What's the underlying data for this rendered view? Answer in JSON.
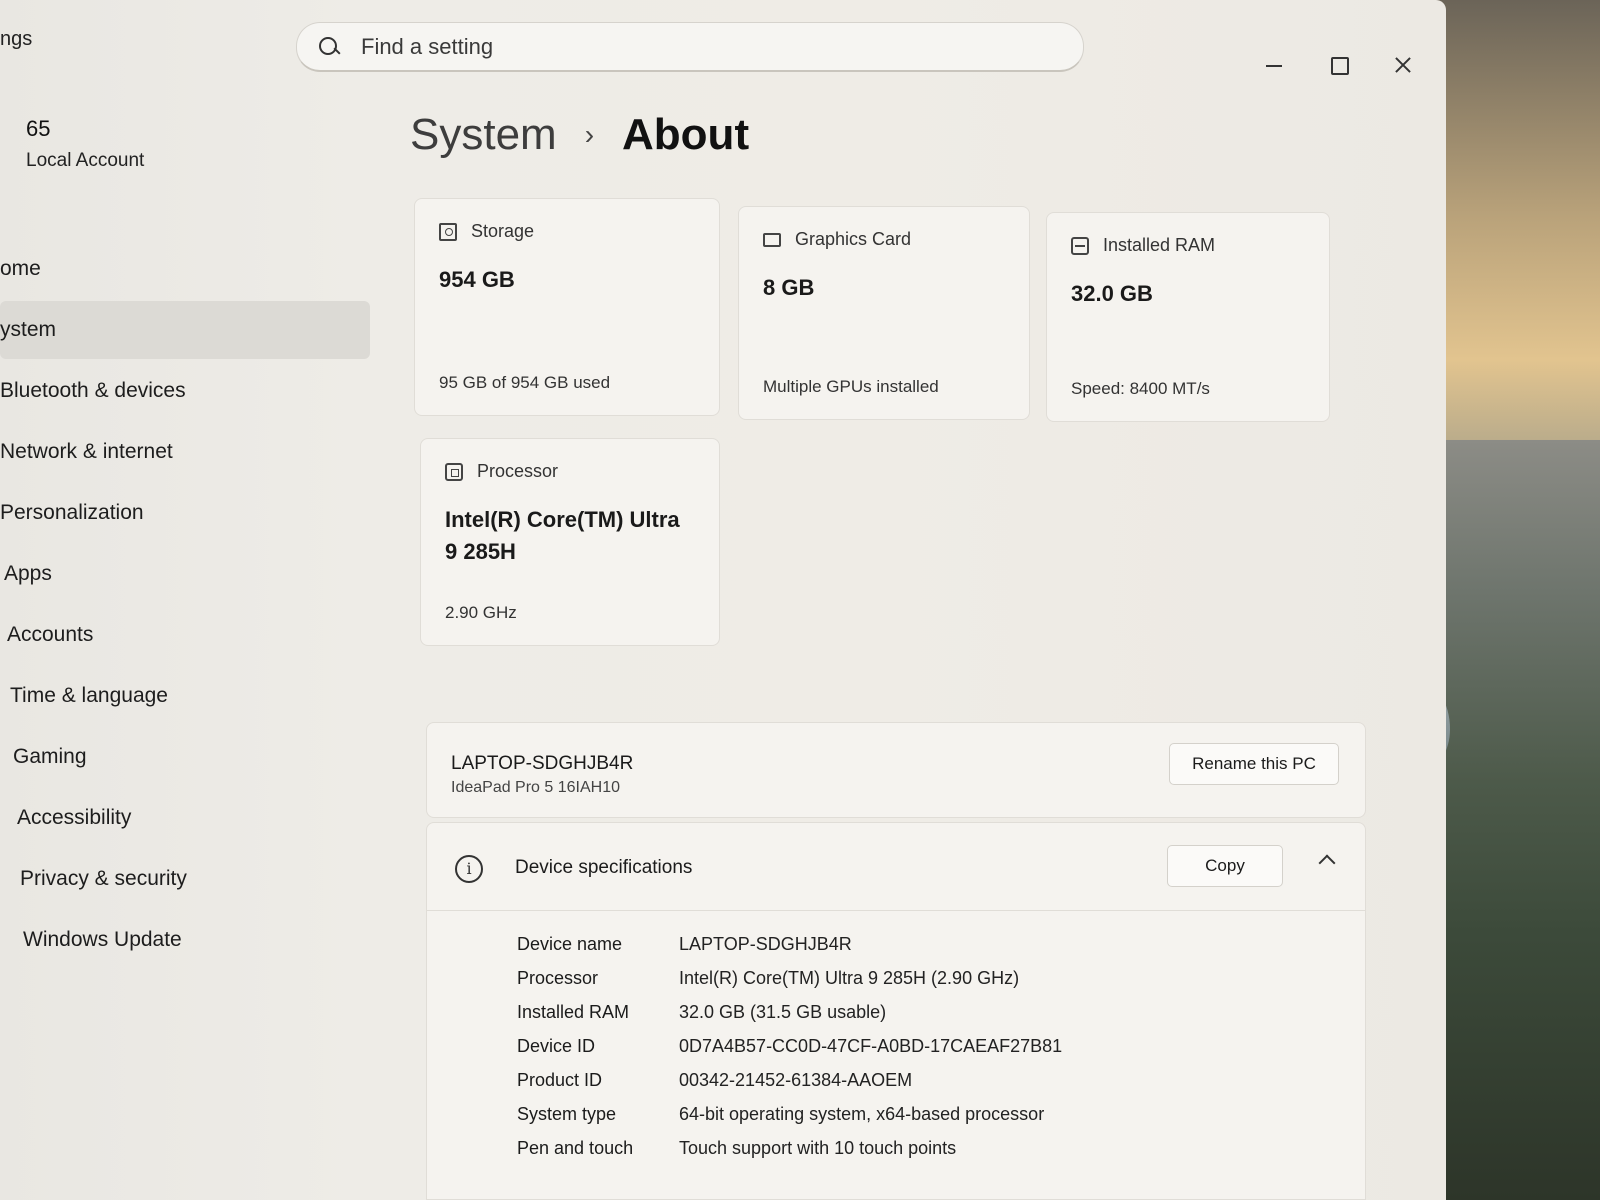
{
  "window": {
    "app_title": "ngs"
  },
  "search": {
    "placeholder": "Find a setting"
  },
  "account": {
    "name": "65",
    "type": "Local Account"
  },
  "sidebar": {
    "items": [
      {
        "label": "ome",
        "selected": false
      },
      {
        "label": "ystem",
        "selected": true
      },
      {
        "label": "Bluetooth & devices",
        "selected": false
      },
      {
        "label": "Network & internet",
        "selected": false
      },
      {
        "label": "Personalization",
        "selected": false
      },
      {
        "label": "Apps",
        "selected": false
      },
      {
        "label": "Accounts",
        "selected": false
      },
      {
        "label": "Time & language",
        "selected": false
      },
      {
        "label": "Gaming",
        "selected": false
      },
      {
        "label": "Accessibility",
        "selected": false
      },
      {
        "label": "Privacy & security",
        "selected": false
      },
      {
        "label": "Windows Update",
        "selected": false
      }
    ]
  },
  "breadcrumb": {
    "parent": "System",
    "separator": "›",
    "current": "About"
  },
  "cards": {
    "storage": {
      "label": "Storage",
      "value": "954 GB",
      "sub": "95 GB of 954 GB used",
      "icon": "storage-icon"
    },
    "graphics": {
      "label": "Graphics Card",
      "value": "8 GB",
      "sub": "Multiple GPUs installed",
      "icon": "graphics-card-icon"
    },
    "ram": {
      "label": "Installed RAM",
      "value": "32.0 GB",
      "sub": "Speed: 8400 MT/s",
      "icon": "ram-icon"
    },
    "processor": {
      "label": "Processor",
      "value": "Intel(R) Core(TM) Ultra 9 285H",
      "sub": "2.90 GHz",
      "icon": "processor-icon"
    }
  },
  "pc": {
    "name": "LAPTOP-SDGHJB4R",
    "model": "IdeaPad Pro 5 16IAH10",
    "rename_label": "Rename this PC"
  },
  "specs": {
    "title": "Device specifications",
    "copy_label": "Copy",
    "info_glyph": "i",
    "rows": [
      {
        "label": "Device name",
        "value": "LAPTOP-SDGHJB4R"
      },
      {
        "label": "Processor",
        "value": "Intel(R) Core(TM) Ultra 9 285H (2.90 GHz)"
      },
      {
        "label": "Installed RAM",
        "value": "32.0 GB (31.5 GB usable)"
      },
      {
        "label": "Device ID",
        "value": "0D7A4B57-CC0D-47CF-A0BD-17CAEAF27B81"
      },
      {
        "label": "Product ID",
        "value": "00342-21452-61384-AAOEM"
      },
      {
        "label": "System type",
        "value": "64-bit operating system, x64-based processor"
      },
      {
        "label": "Pen and touch",
        "value": "Touch support with 10 touch points"
      }
    ]
  }
}
